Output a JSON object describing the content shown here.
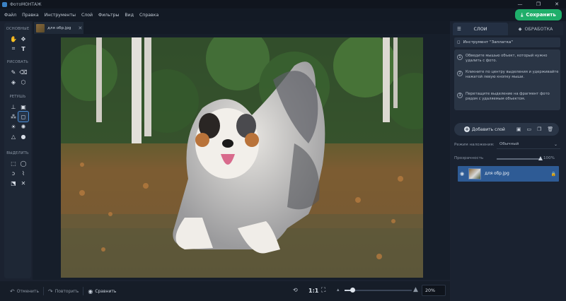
{
  "app": {
    "title": "ФотоМОНТАЖ"
  },
  "window_controls": [
    "—",
    "❐",
    "✕"
  ],
  "menu": [
    "Файл",
    "Правка",
    "Инструменты",
    "Слой",
    "Фильтры",
    "Вид",
    "Справка"
  ],
  "save_button": {
    "label": "Сохранить",
    "icon": "download-icon"
  },
  "toolbox": {
    "sections": [
      {
        "label": "ОСНОВНЫЕ",
        "tools": [
          "hand-icon",
          "move-icon",
          "crop-icon",
          "text-icon"
        ]
      },
      {
        "label": "РИСОВАТЬ",
        "tools": [
          "brush-icon",
          "eraser-icon",
          "fill-icon",
          "shapes-icon"
        ]
      },
      {
        "label": "РЕТУШЬ",
        "tools": [
          "stamp-icon",
          "patch-icon",
          "healing-icon",
          "patch-active-icon",
          "dodge-icon",
          "burn-icon",
          "sharpen-icon",
          "blur-icon"
        ]
      },
      {
        "label": "ВЫДЕЛИТЬ",
        "tools": [
          "rect-select-icon",
          "ellipse-select-icon",
          "lasso-icon",
          "poly-lasso-icon",
          "transform-icon",
          "magic-wand-icon"
        ]
      }
    ]
  },
  "document_tab": {
    "name": "для обр.jpg",
    "close": "✕"
  },
  "bottom": {
    "undo": "Отменить",
    "redo": "Повторить",
    "compare": "Сравнить",
    "zoom_one": "1:1",
    "zoom_value": "20%",
    "zoom_fraction": 0.12
  },
  "right_panel": {
    "tabs": [
      {
        "label": "СЛОИ",
        "active": true
      },
      {
        "label": "ОБРАБОТКА",
        "active": false
      }
    ],
    "tool_header": "Инструмент \"Заплатка\"",
    "steps": [
      {
        "num": "1",
        "text": "Обведите мышью объект, который нужно удалить с фото."
      },
      {
        "num": "2",
        "text": "Кликните по центру выделения и удерживайте нажатой левую кнопку мыши."
      },
      {
        "num": "3",
        "text": "Перетащите выделение на фрагмент фото рядом с удаляемым объектом."
      }
    ],
    "add_layer": "Добавить слой",
    "blend_label": "Режим наложения:",
    "blend_value": "Обычный",
    "opacity_label": "Прозрачность",
    "opacity_value": "100%",
    "opacity_fraction": 1.0,
    "layer": {
      "name": "для обр.jpg"
    }
  },
  "colors": {
    "accent": "#1fae6a",
    "selection": "#2e5b95",
    "bg": "#1b2230"
  }
}
